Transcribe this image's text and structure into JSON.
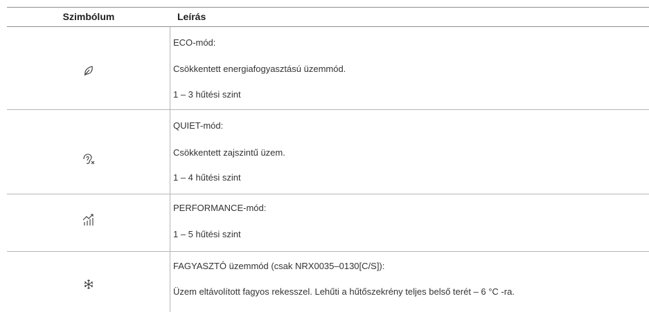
{
  "header": {
    "col_symbol": "Szimbólum",
    "col_description": "Leírás"
  },
  "rows": [
    {
      "icon": "leaf-icon",
      "lines": [
        "ECO-mód:",
        "Csökkentett energiafogyasztású üzemmód.",
        "1 – 3 hűtési szint"
      ]
    },
    {
      "icon": "ear-mute-icon",
      "lines": [
        "QUIET-mód:",
        "Csökkentett zajszintű üzem.",
        "1 – 4 hűtési szint"
      ]
    },
    {
      "icon": "performance-chart-icon",
      "lines": [
        "PERFORMANCE-mód:",
        "1 – 5 hűtési szint"
      ]
    },
    {
      "icon": "snowflake-icon",
      "lines": [
        "FAGYASZTÓ üzemmód (csak NRX0035–0130[C/S]):",
        "Üzem eltávolított fagyos rekesszel.  Lehűti a hűtőszekrény teljes belső terét  – 6 °C -ra."
      ]
    }
  ]
}
